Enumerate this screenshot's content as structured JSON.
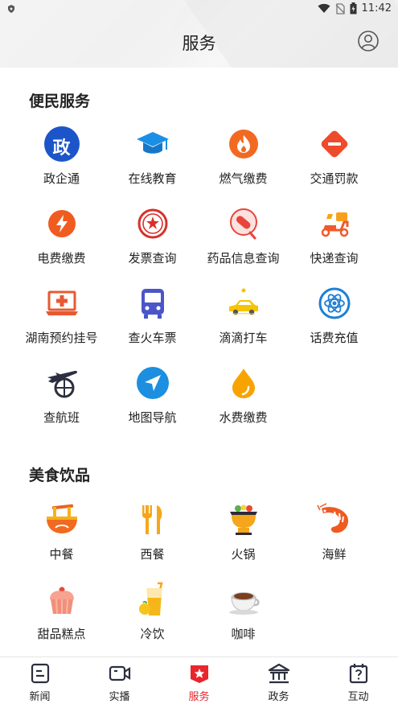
{
  "status_bar": {
    "time": "11:42"
  },
  "header": {
    "title": "服务"
  },
  "sections": [
    {
      "title": "便民服务",
      "items": [
        {
          "label": "政企通",
          "icon": "gov-icon"
        },
        {
          "label": "在线教育",
          "icon": "graduation-cap-icon"
        },
        {
          "label": "燃气缴费",
          "icon": "flame-icon"
        },
        {
          "label": "交通罚款",
          "icon": "traffic-sign-icon"
        },
        {
          "label": "电费缴费",
          "icon": "lightning-icon"
        },
        {
          "label": "发票查询",
          "icon": "seal-icon"
        },
        {
          "label": "药品信息查询",
          "icon": "pill-icon"
        },
        {
          "label": "快递查询",
          "icon": "delivery-scooter-icon"
        },
        {
          "label": "湖南预约挂号",
          "icon": "medical-laptop-icon"
        },
        {
          "label": "查火车票",
          "icon": "train-icon"
        },
        {
          "label": "滴滴打车",
          "icon": "taxi-icon"
        },
        {
          "label": "话费充值",
          "icon": "atom-icon"
        },
        {
          "label": "查航班",
          "icon": "airplane-globe-icon"
        },
        {
          "label": "地图导航",
          "icon": "navigation-arrow-icon"
        },
        {
          "label": "水费缴费",
          "icon": "water-drop-icon"
        }
      ]
    },
    {
      "title": "美食饮品",
      "items": [
        {
          "label": "中餐",
          "icon": "noodle-bowl-icon"
        },
        {
          "label": "西餐",
          "icon": "fork-knife-icon"
        },
        {
          "label": "火锅",
          "icon": "hotpot-icon"
        },
        {
          "label": "海鲜",
          "icon": "shrimp-icon"
        },
        {
          "label": "甜品糕点",
          "icon": "cupcake-icon"
        },
        {
          "label": "冷饮",
          "icon": "cold-drink-icon"
        },
        {
          "label": "咖啡",
          "icon": "coffee-cup-icon"
        }
      ]
    }
  ],
  "tabbar": {
    "items": [
      {
        "label": "新闻",
        "icon": "news-icon",
        "active": false
      },
      {
        "label": "实播",
        "icon": "video-camera-icon",
        "active": false
      },
      {
        "label": "服务",
        "icon": "service-star-icon",
        "active": true
      },
      {
        "label": "政务",
        "icon": "government-building-icon",
        "active": false
      },
      {
        "label": "互动",
        "icon": "question-calendar-icon",
        "active": false
      }
    ]
  },
  "colors": {
    "active_tab": "#e8262c",
    "text": "#222222"
  }
}
